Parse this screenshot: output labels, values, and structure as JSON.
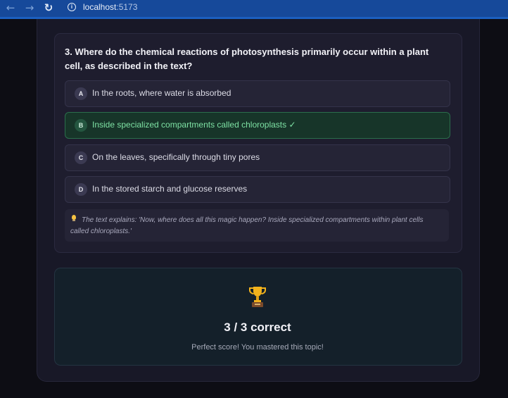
{
  "browser": {
    "url_host": "localhost",
    "url_port": ":5173",
    "back_icon": "arrow-left-icon",
    "forward_icon": "arrow-right-icon",
    "reload_icon": "reload-icon",
    "info_icon": "info-icon"
  },
  "question": {
    "text": "3. Where do the chemical reactions of photosynthesis primarily occur within a plant cell, as described in the text?",
    "options": [
      {
        "letter": "A",
        "text": "In the roots, where water is absorbed",
        "state": "neutral"
      },
      {
        "letter": "B",
        "text": "Inside specialized compartments called chloroplasts ✓",
        "state": "correct"
      },
      {
        "letter": "C",
        "text": "On the leaves, specifically through tiny pores",
        "state": "neutral"
      },
      {
        "letter": "D",
        "text": "In the stored starch and glucose reserves",
        "state": "neutral"
      }
    ],
    "explanation": "The text explains: 'Now, where does all this magic happen? Inside specialized compartments within plant cells called chloroplasts.'",
    "explanation_icon": "lightbulb-icon"
  },
  "result": {
    "icon": "trophy-icon",
    "score": "3 / 3 correct",
    "message": "Perfect score! You mastered this topic!"
  },
  "colors": {
    "correct_green": "#7ee2a4",
    "browser_blue": "#16499a"
  }
}
